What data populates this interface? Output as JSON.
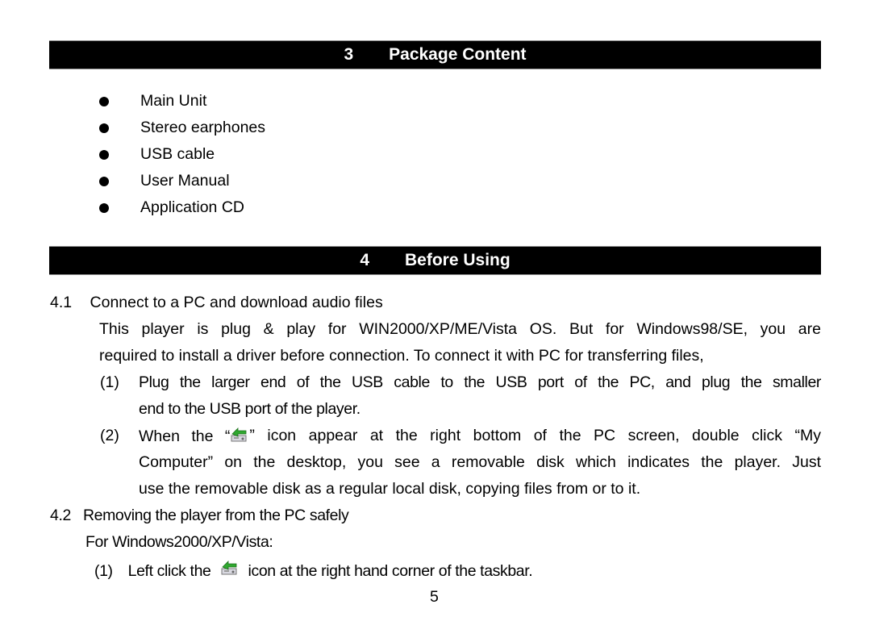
{
  "section3": {
    "number": "3",
    "title": "Package Content",
    "items": [
      "Main Unit",
      "Stereo earphones",
      "USB cable",
      "User Manual",
      "Application CD"
    ]
  },
  "section4": {
    "number": "4",
    "title": "Before Using",
    "sub1": {
      "number": "4.1",
      "title": "Connect to a PC and download audio files",
      "para_line1": "This player is plug & play for WIN2000/XP/ME/Vista OS. But for Windows98/SE, you are",
      "para_line2": "required to install a driver before connection. To connect it with PC for transferring files,",
      "step1": {
        "num": "(1)",
        "line1": "Plug the larger end of the USB cable to the USB port of the PC, and plug the smaller",
        "line2": "end to the USB port of the player."
      },
      "step2": {
        "num": "(2)",
        "line1_pre": "When the “",
        "line1_post": "” icon appear at the right bottom of the PC screen, double click “My",
        "line2": "Computer” on the desktop, you see a removable disk which indicates the player. Just",
        "line3": "use the removable disk as a regular local disk, copying files from or to it.",
        "icon": "safely-remove-hardware-icon"
      }
    },
    "sub2": {
      "number": "4.2",
      "title": "Removing the player from the PC safely",
      "os_label": "For Windows2000/XP/Vista:",
      "step1": {
        "num": "(1)",
        "pre": "Left click the",
        "post": "icon at the right hand corner of the taskbar.",
        "icon": "safely-remove-hardware-icon"
      }
    }
  },
  "page_number": "5",
  "colors": {
    "header_bg": "#000000",
    "header_text": "#ffffff",
    "icon_green": "#2fa82f"
  }
}
